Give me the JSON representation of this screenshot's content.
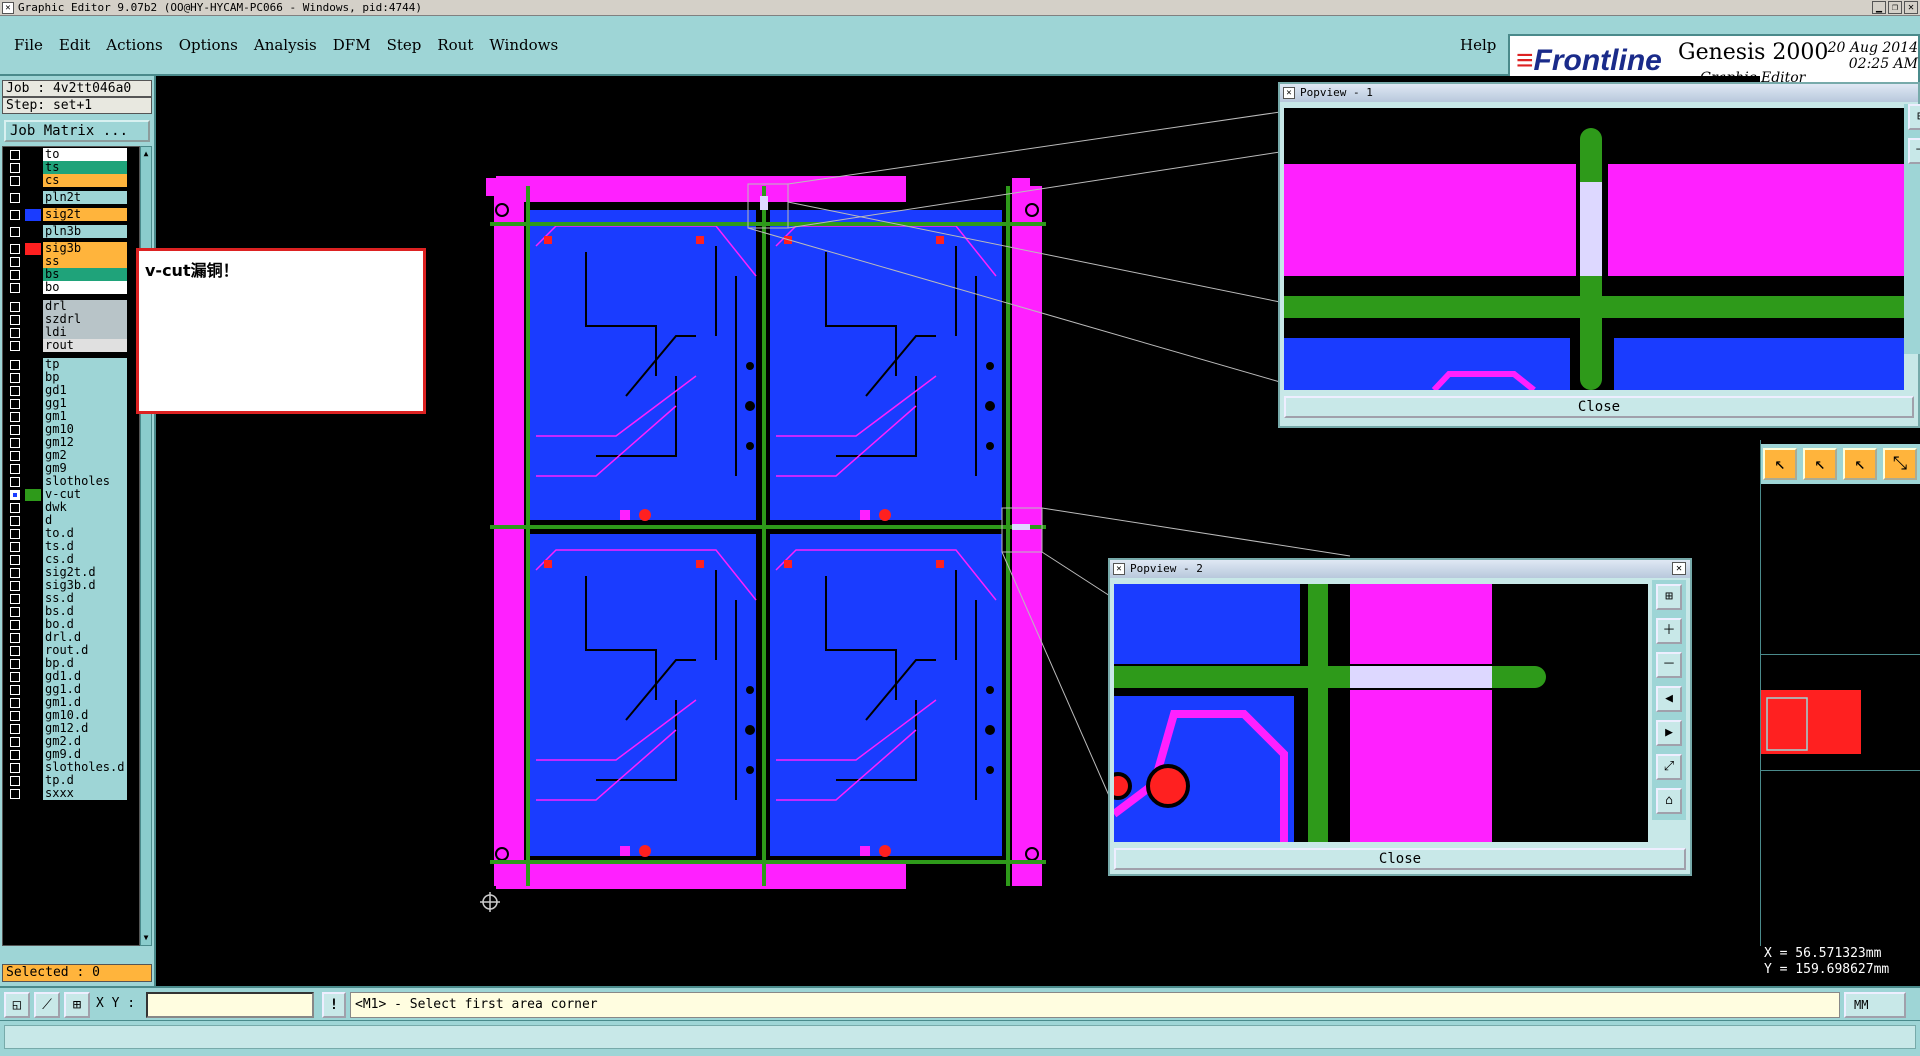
{
  "window": {
    "title": "Graphic Editor 9.07b2 (OO@HY-HYCAM-PC066 - Windows, pid:4744)"
  },
  "menu": {
    "items": [
      "File",
      "Edit",
      "Actions",
      "Options",
      "Analysis",
      "DFM",
      "Step",
      "Rout",
      "Windows"
    ],
    "help": "Help"
  },
  "brand": {
    "logo": "Frontline",
    "product": "Genesis 2000",
    "subtitle": "Graphic Editor",
    "date": "20 Aug 2014",
    "time": "02:25 AM"
  },
  "job": {
    "job_label": "Job : 4v2tt046a0",
    "step_label": "Step: set+1",
    "matrix_button": "Job Matrix ..."
  },
  "layers": [
    {
      "name": "to",
      "bg": "#ffffff",
      "swatch": "",
      "checked": false
    },
    {
      "name": "ts",
      "bg": "#1fa37a",
      "swatch": "",
      "checked": false
    },
    {
      "name": "cs",
      "bg": "#ffb43c",
      "swatch": "",
      "checked": false
    },
    {
      "name": "pln2t",
      "bg": "#9ed5d6",
      "swatch": "",
      "checked": false
    },
    {
      "name": "sig2t",
      "bg": "#ffb43c",
      "swatch": "#1a3cff",
      "checked": false
    },
    {
      "name": "pln3b",
      "bg": "#9ed5d6",
      "swatch": "",
      "checked": false
    },
    {
      "name": "sig3b",
      "bg": "#ffb43c",
      "swatch": "#ff2020",
      "checked": false
    },
    {
      "name": "ss",
      "bg": "#ffb43c",
      "swatch": "",
      "checked": false
    },
    {
      "name": "bs",
      "bg": "#1fa37a",
      "swatch": "",
      "checked": false
    },
    {
      "name": "bo",
      "bg": "#ffffff",
      "swatch": "",
      "checked": false
    },
    {
      "name": "drl",
      "bg": "#b8c4c8",
      "swatch": "",
      "checked": false
    },
    {
      "name": "szdrl",
      "bg": "#b8c4c8",
      "swatch": "",
      "checked": false
    },
    {
      "name": "ldi",
      "bg": "#b8c4c8",
      "swatch": "",
      "checked": false
    },
    {
      "name": "rout",
      "bg": "#e0e0e0",
      "swatch": "",
      "checked": false
    },
    {
      "name": "tp",
      "bg": "#9ed5d6",
      "swatch": "",
      "checked": false
    },
    {
      "name": "bp",
      "bg": "#9ed5d6",
      "swatch": "",
      "checked": false
    },
    {
      "name": "gd1",
      "bg": "#9ed5d6",
      "swatch": "",
      "checked": false
    },
    {
      "name": "gg1",
      "bg": "#9ed5d6",
      "swatch": "",
      "checked": false
    },
    {
      "name": "gm1",
      "bg": "#9ed5d6",
      "swatch": "",
      "checked": false
    },
    {
      "name": "gm10",
      "bg": "#9ed5d6",
      "swatch": "",
      "checked": false
    },
    {
      "name": "gm12",
      "bg": "#9ed5d6",
      "swatch": "",
      "checked": false
    },
    {
      "name": "gm2",
      "bg": "#9ed5d6",
      "swatch": "",
      "checked": false
    },
    {
      "name": "gm9",
      "bg": "#9ed5d6",
      "swatch": "",
      "checked": false
    },
    {
      "name": "slotholes",
      "bg": "#9ed5d6",
      "swatch": "",
      "checked": false
    },
    {
      "name": "v-cut",
      "bg": "#9ed5d6",
      "swatch": "#2e9a1a",
      "checked": true
    },
    {
      "name": "dwk",
      "bg": "#9ed5d6",
      "swatch": "",
      "checked": false
    },
    {
      "name": "d",
      "bg": "#9ed5d6",
      "swatch": "",
      "checked": false
    },
    {
      "name": "to.d",
      "bg": "#9ed5d6",
      "swatch": "",
      "checked": false
    },
    {
      "name": "ts.d",
      "bg": "#9ed5d6",
      "swatch": "",
      "checked": false
    },
    {
      "name": "cs.d",
      "bg": "#9ed5d6",
      "swatch": "",
      "checked": false
    },
    {
      "name": "sig2t.d",
      "bg": "#9ed5d6",
      "swatch": "",
      "checked": false
    },
    {
      "name": "sig3b.d",
      "bg": "#9ed5d6",
      "swatch": "",
      "checked": false
    },
    {
      "name": "ss.d",
      "bg": "#9ed5d6",
      "swatch": "",
      "checked": false
    },
    {
      "name": "bs.d",
      "bg": "#9ed5d6",
      "swatch": "",
      "checked": false
    },
    {
      "name": "bo.d",
      "bg": "#9ed5d6",
      "swatch": "",
      "checked": false
    },
    {
      "name": "drl.d",
      "bg": "#9ed5d6",
      "swatch": "",
      "checked": false
    },
    {
      "name": "rout.d",
      "bg": "#9ed5d6",
      "swatch": "",
      "checked": false
    },
    {
      "name": "bp.d",
      "bg": "#9ed5d6",
      "swatch": "",
      "checked": false
    },
    {
      "name": "gd1.d",
      "bg": "#9ed5d6",
      "swatch": "",
      "checked": false
    },
    {
      "name": "gg1.d",
      "bg": "#9ed5d6",
      "swatch": "",
      "checked": false
    },
    {
      "name": "gm1.d",
      "bg": "#9ed5d6",
      "swatch": "",
      "checked": false
    },
    {
      "name": "gm10.d",
      "bg": "#9ed5d6",
      "swatch": "",
      "checked": false
    },
    {
      "name": "gm12.d",
      "bg": "#9ed5d6",
      "swatch": "",
      "checked": false
    },
    {
      "name": "gm2.d",
      "bg": "#9ed5d6",
      "swatch": "",
      "checked": false
    },
    {
      "name": "gm9.d",
      "bg": "#9ed5d6",
      "swatch": "",
      "checked": false
    },
    {
      "name": "slotholes.d",
      "bg": "#9ed5d6",
      "swatch": "",
      "checked": false
    },
    {
      "name": "tp.d",
      "bg": "#9ed5d6",
      "swatch": "",
      "checked": false
    },
    {
      "name": "sxxx",
      "bg": "#9ed5d6",
      "swatch": "",
      "checked": false
    }
  ],
  "selected": "Selected : 0",
  "annotation": "v-cut漏铜！",
  "popview1": {
    "title": "Popview - 1",
    "close": "Close"
  },
  "popview2": {
    "title": "Popview - 2",
    "close": "Close"
  },
  "coords": {
    "x": "X =  56.571323mm",
    "y": "Y = 159.698627mm"
  },
  "bottom": {
    "xy_label": "X Y :",
    "xy_value": "",
    "bang": "!",
    "prompt": "<M1> - Select first area corner",
    "units": "MM"
  },
  "icons": {
    "window_close": "close-icon",
    "window_minimize": "minimize-icon",
    "window_maximize": "maximize-icon"
  },
  "colors": {
    "ui_bg": "#9ed5d6",
    "copper": "#1a3cff",
    "soldermask": "#ff20ff",
    "vcut": "#2e9a1a",
    "pad": "#ff2020",
    "highlight": "#ffb43c"
  }
}
